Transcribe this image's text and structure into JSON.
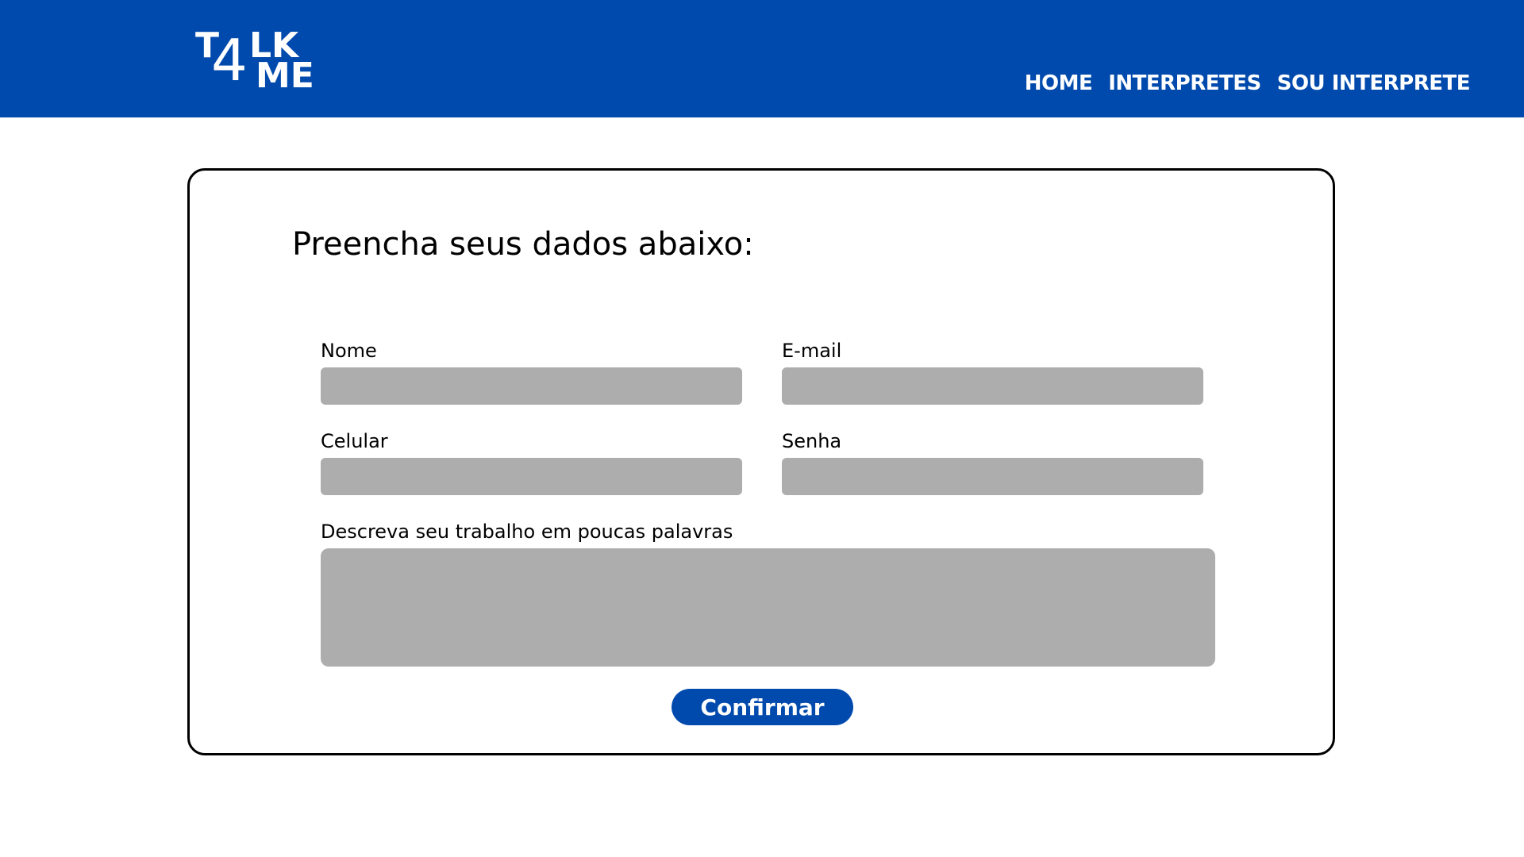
{
  "header": {
    "logo": {
      "text": "T4LK ME",
      "part_t": "T",
      "part_4": "4",
      "part_lk": "LK",
      "part_me": "ME"
    },
    "nav": {
      "home": "HOME",
      "interpretes": "INTERPRETES",
      "sou_interprete": "SOU INTERPRETE"
    }
  },
  "form": {
    "title": "Preencha seus dados abaixo:",
    "fields": {
      "nome": {
        "label": "Nome",
        "value": ""
      },
      "email": {
        "label": "E-mail",
        "value": ""
      },
      "celular": {
        "label": "Celular",
        "value": ""
      },
      "senha": {
        "label": "Senha",
        "value": ""
      },
      "descricao": {
        "label": "Descreva seu trabalho em poucas palavras",
        "value": ""
      }
    },
    "confirm_label": "Confirmar"
  },
  "colors": {
    "brand_blue": "#004aad",
    "field_gray": "#adadad",
    "background": "#ffffff"
  }
}
